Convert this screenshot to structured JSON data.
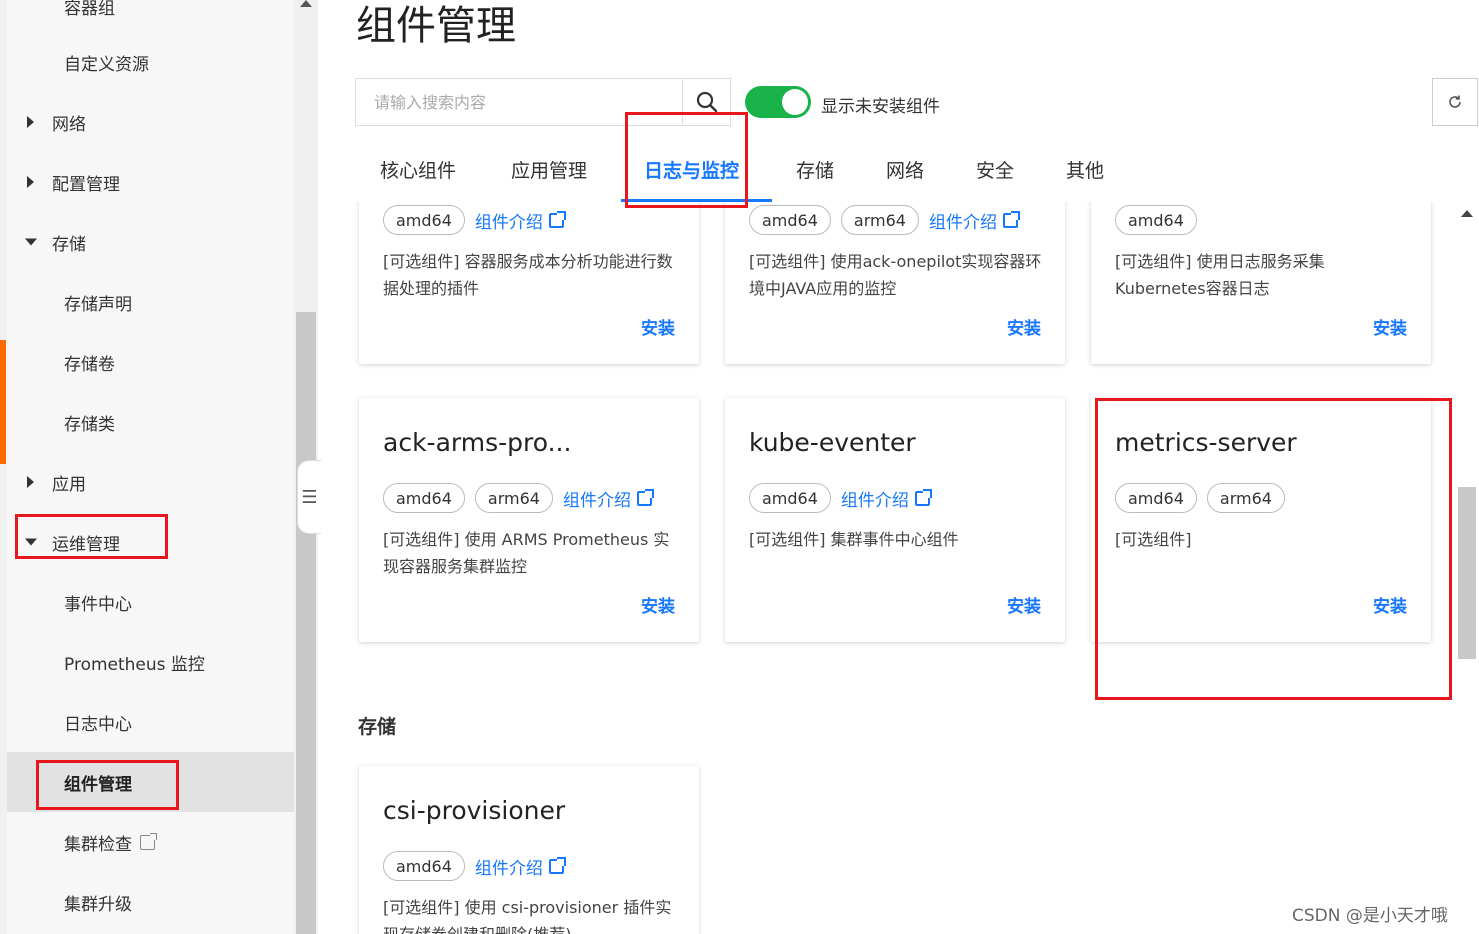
{
  "sidebar": {
    "items": [
      {
        "label": "容器组",
        "kind": "sub"
      },
      {
        "label": "自定义资源",
        "kind": "sub"
      },
      {
        "label": "网络",
        "kind": "parent",
        "expanded": false
      },
      {
        "label": "配置管理",
        "kind": "parent",
        "expanded": false
      },
      {
        "label": "存储",
        "kind": "parent",
        "expanded": true
      },
      {
        "label": "存储声明",
        "kind": "sub"
      },
      {
        "label": "存储卷",
        "kind": "sub"
      },
      {
        "label": "存储类",
        "kind": "sub"
      },
      {
        "label": "应用",
        "kind": "parent",
        "expanded": false
      },
      {
        "label": "运维管理",
        "kind": "parent",
        "expanded": true
      },
      {
        "label": "事件中心",
        "kind": "sub"
      },
      {
        "label": "Prometheus 监控",
        "kind": "sub"
      },
      {
        "label": "日志中心",
        "kind": "sub"
      },
      {
        "label": "组件管理",
        "kind": "sub",
        "active": true
      },
      {
        "label": "集群检查",
        "kind": "sub",
        "external": true
      },
      {
        "label": "集群升级",
        "kind": "sub"
      }
    ]
  },
  "header": {
    "title": "组件管理",
    "search_placeholder": "请输入搜索内容",
    "toggle_label": "显示未安装组件",
    "toggle_on": true
  },
  "tabs": [
    {
      "label": "核心组件"
    },
    {
      "label": "应用管理"
    },
    {
      "label": "日志与监控",
      "active": true
    },
    {
      "label": "存储"
    },
    {
      "label": "网络"
    },
    {
      "label": "安全"
    },
    {
      "label": "其他"
    }
  ],
  "cards_top": [
    {
      "tags": [
        "amd64"
      ],
      "intro": "组件介绍",
      "desc": "[可选组件] 容器服务成本分析功能进行数据处理的插件",
      "install": "安装"
    },
    {
      "tags": [
        "amd64",
        "arm64"
      ],
      "intro": "组件介绍",
      "desc": "[可选组件] 使用ack-onepilot实现容器环境中JAVA应用的监控",
      "install": "安装"
    },
    {
      "tags": [
        "amd64"
      ],
      "intro": "",
      "desc": "[可选组件] 使用日志服务采集Kubernetes容器日志",
      "install": "安装"
    }
  ],
  "cards_mid": [
    {
      "title": "ack-arms-pro...",
      "tags": [
        "amd64",
        "arm64"
      ],
      "intro": "组件介绍",
      "desc": "[可选组件] 使用 ARMS Prometheus 实现容器服务集群监控",
      "install": "安装"
    },
    {
      "title": "kube-eventer",
      "tags": [
        "amd64"
      ],
      "intro": "组件介绍",
      "desc": "[可选组件] 集群事件中心组件",
      "install": "安装"
    },
    {
      "title": "metrics-server",
      "tags": [
        "amd64",
        "arm64"
      ],
      "intro": "",
      "desc": "[可选组件]",
      "install": "安装"
    }
  ],
  "storage_section": {
    "title": "存储",
    "card": {
      "title": "csi-provisioner",
      "tags": [
        "amd64"
      ],
      "intro": "组件介绍",
      "desc": "[可选组件] 使用 csi-provisioner 插件实现存储卷创建和删除(推荐)"
    }
  },
  "watermark": "CSDN @是小天才哦",
  "colors": {
    "accent": "#1677ff",
    "toggle": "#1ab34a",
    "highlight": "#e8161d",
    "brand_bar": "#ff6a00"
  }
}
